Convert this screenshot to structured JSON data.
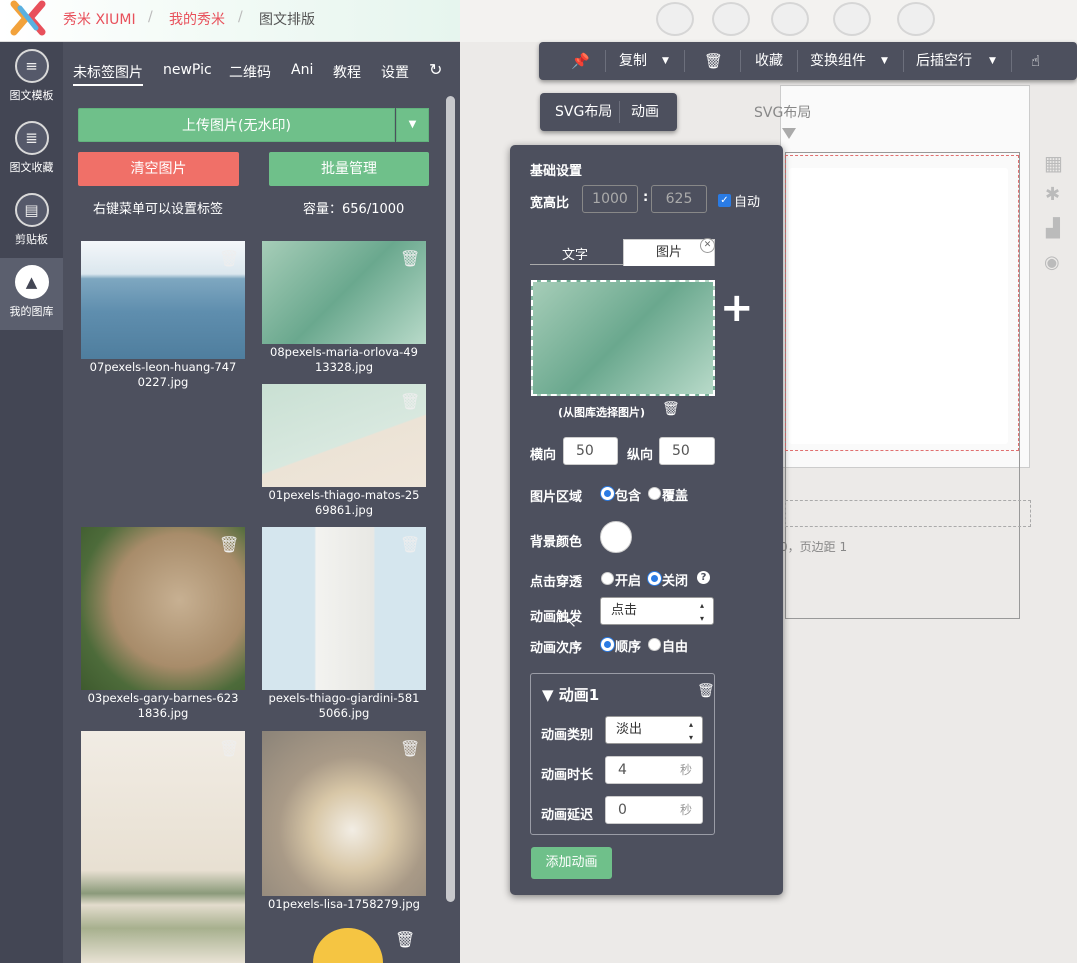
{
  "app": {
    "brand": "秀米 XIUMI",
    "breadcrumb": [
      "我的秀米",
      "图文排版"
    ],
    "separator": "/"
  },
  "rail": [
    {
      "label": "图文模板",
      "icon": "list-icon"
    },
    {
      "label": "图文收藏",
      "icon": "favorites-list-icon"
    },
    {
      "label": "剪贴板",
      "icon": "clipboard-icon"
    },
    {
      "label": "我的图库",
      "icon": "image-library-icon"
    }
  ],
  "library": {
    "tabs": [
      "未标签图片",
      "newPic",
      "二维码",
      "Ani",
      "教程",
      "设置"
    ],
    "upload_label": "上传图片(无水印)",
    "clear_label": "清空图片",
    "batch_label": "批量管理",
    "hint": "右键菜单可以设置标签",
    "capacity": "容量：656/1000",
    "images": [
      {
        "name": "07pexels-leon-huang-747\n0227.jpg"
      },
      {
        "name": "08pexels-maria-orlova-49\n13328.jpg"
      },
      {
        "name": "01pexels-thiago-matos-25\n69861.jpg"
      },
      {
        "name": "03pexels-gary-barnes-623\n1836.jpg"
      },
      {
        "name": "pexels-thiago-giardini-581\n5066.jpg"
      },
      {
        "name": ""
      },
      {
        "name": "01pexels-lisa-1758279.jpg"
      }
    ]
  },
  "toolbar": {
    "items": [
      "复制",
      "收藏",
      "变换组件",
      "后插空行"
    ]
  },
  "layout_tabs": [
    "SVG布局",
    "动画"
  ],
  "canvas": {
    "title": "SVG布局",
    "page_text": "0，页边距 1"
  },
  "settings": {
    "section": "基础设置",
    "ratio_label": "宽高比",
    "ratio_w": "1000",
    "ratio_h": "625",
    "auto_label": "自动",
    "tab_text": "文字",
    "tab_image": "图片",
    "choose_label": "(从图库选择图片)",
    "h_label": "横向",
    "h_value": "50",
    "v_label": "纵向",
    "v_value": "50",
    "area_label": "图片区域",
    "area_opt1": "包含",
    "area_opt2": "覆盖",
    "bg_label": "背景颜色",
    "click_label": "点击穿透",
    "click_on": "开启",
    "click_off": "关闭",
    "trigger_label": "动画触发",
    "trigger_value": "点击",
    "order_label": "动画次序",
    "order_opt1": "顺序",
    "order_opt2": "自由",
    "anim_title": "▼ 动画1",
    "anim_type_label": "动画类别",
    "anim_type_value": "淡出",
    "anim_dur_label": "动画时长",
    "anim_dur_value": "4",
    "anim_delay_label": "动画延迟",
    "anim_delay_value": "0",
    "unit": "秒",
    "add_label": "添加动画"
  }
}
